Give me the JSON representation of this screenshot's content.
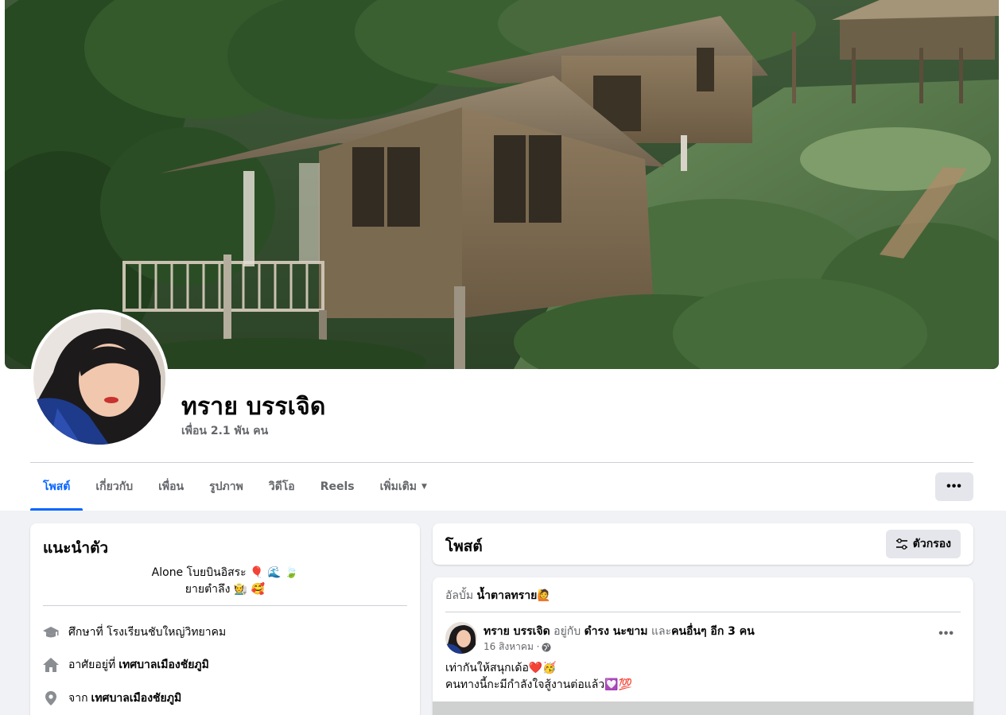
{
  "profile": {
    "name": "ทราย บรรเจิด",
    "friends": "เพื่อน 2.1 พัน คน"
  },
  "tabs": [
    {
      "label": "โพสต์"
    },
    {
      "label": "เกี่ยวกับ"
    },
    {
      "label": "เพื่อน"
    },
    {
      "label": "รูปภาพ"
    },
    {
      "label": "วิดีโอ"
    },
    {
      "label": "Reels"
    },
    {
      "label": "เพิ่มเติม"
    }
  ],
  "more_button": "•••",
  "intro": {
    "title": "แนะนำตัว",
    "bio_line1": "Alone โบยบินอิสระ 🎈 🌊 🍃",
    "bio_line2": "ยายตำลึง 🧑‍🌾 🥰",
    "education_prefix": "ศึกษาที่ โรงเรียนชับใหญ่วิทยาคม",
    "lives_prefix": "อาศัยอยู่ที่",
    "lives_place": "เทศบาลเมืองชัยภูมิ",
    "from_prefix": "จาก",
    "from_place": "เทศบาลเมืองชัยภูมิ"
  },
  "posts": {
    "title": "โพสต์",
    "filter_label": "ตัวกรอง"
  },
  "post": {
    "album_prefix": "อัลบั้ม",
    "album_name": "น้ำตาลทราย🙋",
    "author": "ทราย บรรเจิด",
    "with_text": "อยู่กับ",
    "tagged": "ดำรง นะขาม",
    "and_text": "และ",
    "others": "คนอื่นๆ อีก 3 คน",
    "date": "16 สิงหาคม ·",
    "options": "•••",
    "line1": "เท่ากันให้สนุกเด้อ❤️🥳",
    "line2": "คนทางนี้กะมีกำลังใจสู้งานต่อแล้ว💟💯"
  },
  "colors": {
    "accent": "#0866ff",
    "secondary_text": "#65676b",
    "button_bg": "#e4e6eb",
    "page_bg": "#f0f2f5"
  },
  "icons": {
    "education": "graduation-cap-icon",
    "home": "home-icon",
    "location": "location-pin-icon",
    "filter": "filter-sliders-icon",
    "privacy": "globe-icon"
  }
}
